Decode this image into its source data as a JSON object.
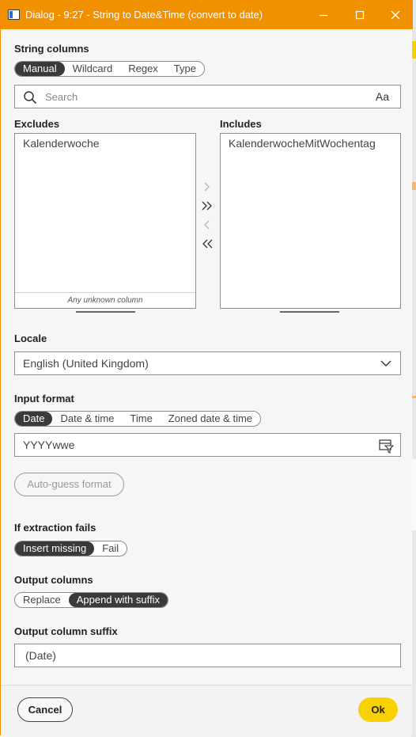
{
  "window": {
    "title": "Dialog - 9:27 - String to Date&Time (convert to date)"
  },
  "colors": {
    "title_bar": "#f29100",
    "segment_active": "#3a3a3a",
    "ok_button": "#f7d100"
  },
  "string_columns": {
    "label": "String columns",
    "modes": [
      "Manual",
      "Wildcard",
      "Regex",
      "Type"
    ],
    "selected_mode": "Manual",
    "search_placeholder": "Search",
    "case_toggle": "Aa",
    "excludes_label": "Excludes",
    "includes_label": "Includes",
    "excludes": [
      "Kalenderwoche"
    ],
    "includes": [
      "KalenderwocheMitWochentag"
    ],
    "unknown_column_label": "Any unknown column"
  },
  "locale": {
    "label": "Locale",
    "value": "English (United Kingdom)"
  },
  "input_format": {
    "label": "Input format",
    "modes": [
      "Date",
      "Date & time",
      "Time",
      "Zoned date & time"
    ],
    "selected_mode": "Date",
    "value": "YYYYwwe",
    "auto_guess_label": "Auto-guess format"
  },
  "if_extraction_fails": {
    "label": "If extraction fails",
    "options": [
      "Insert missing",
      "Fail"
    ],
    "selected": "Insert missing"
  },
  "output_columns": {
    "label": "Output columns",
    "options": [
      "Replace",
      "Append with suffix"
    ],
    "selected": "Append with suffix"
  },
  "output_suffix": {
    "label": "Output column suffix",
    "value": "(Date)"
  },
  "footer": {
    "cancel_label": "Cancel",
    "ok_label": "Ok"
  }
}
